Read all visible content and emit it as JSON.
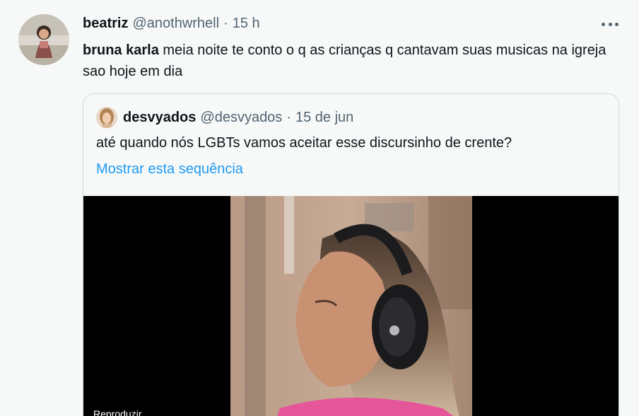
{
  "tweet": {
    "display_name": "beatriz",
    "handle": "@anothwrhell",
    "separator": "·",
    "time": "15 h",
    "mention": "bruna karla",
    "text": " meia noite te conto o q as crianças q cantavam suas musicas na igreja sao hoje em dia",
    "avatar_icon": "profile-photo"
  },
  "quoted": {
    "display_name": "desvyados",
    "handle": "@desvyados",
    "separator": "·",
    "date": "15 de jun",
    "text": "até quando nós LGBTs vamos aceitar esse discursinho de crente?",
    "show_thread": "Mostrar esta sequência",
    "avatar_icon": "profile-photo",
    "video": {
      "play_label": "Reproduzir"
    }
  },
  "colors": {
    "background": "#f7f9f9",
    "text": "#0f1419",
    "secondary": "#536471",
    "link": "#1d9bf0",
    "border": "#cfd9de"
  }
}
